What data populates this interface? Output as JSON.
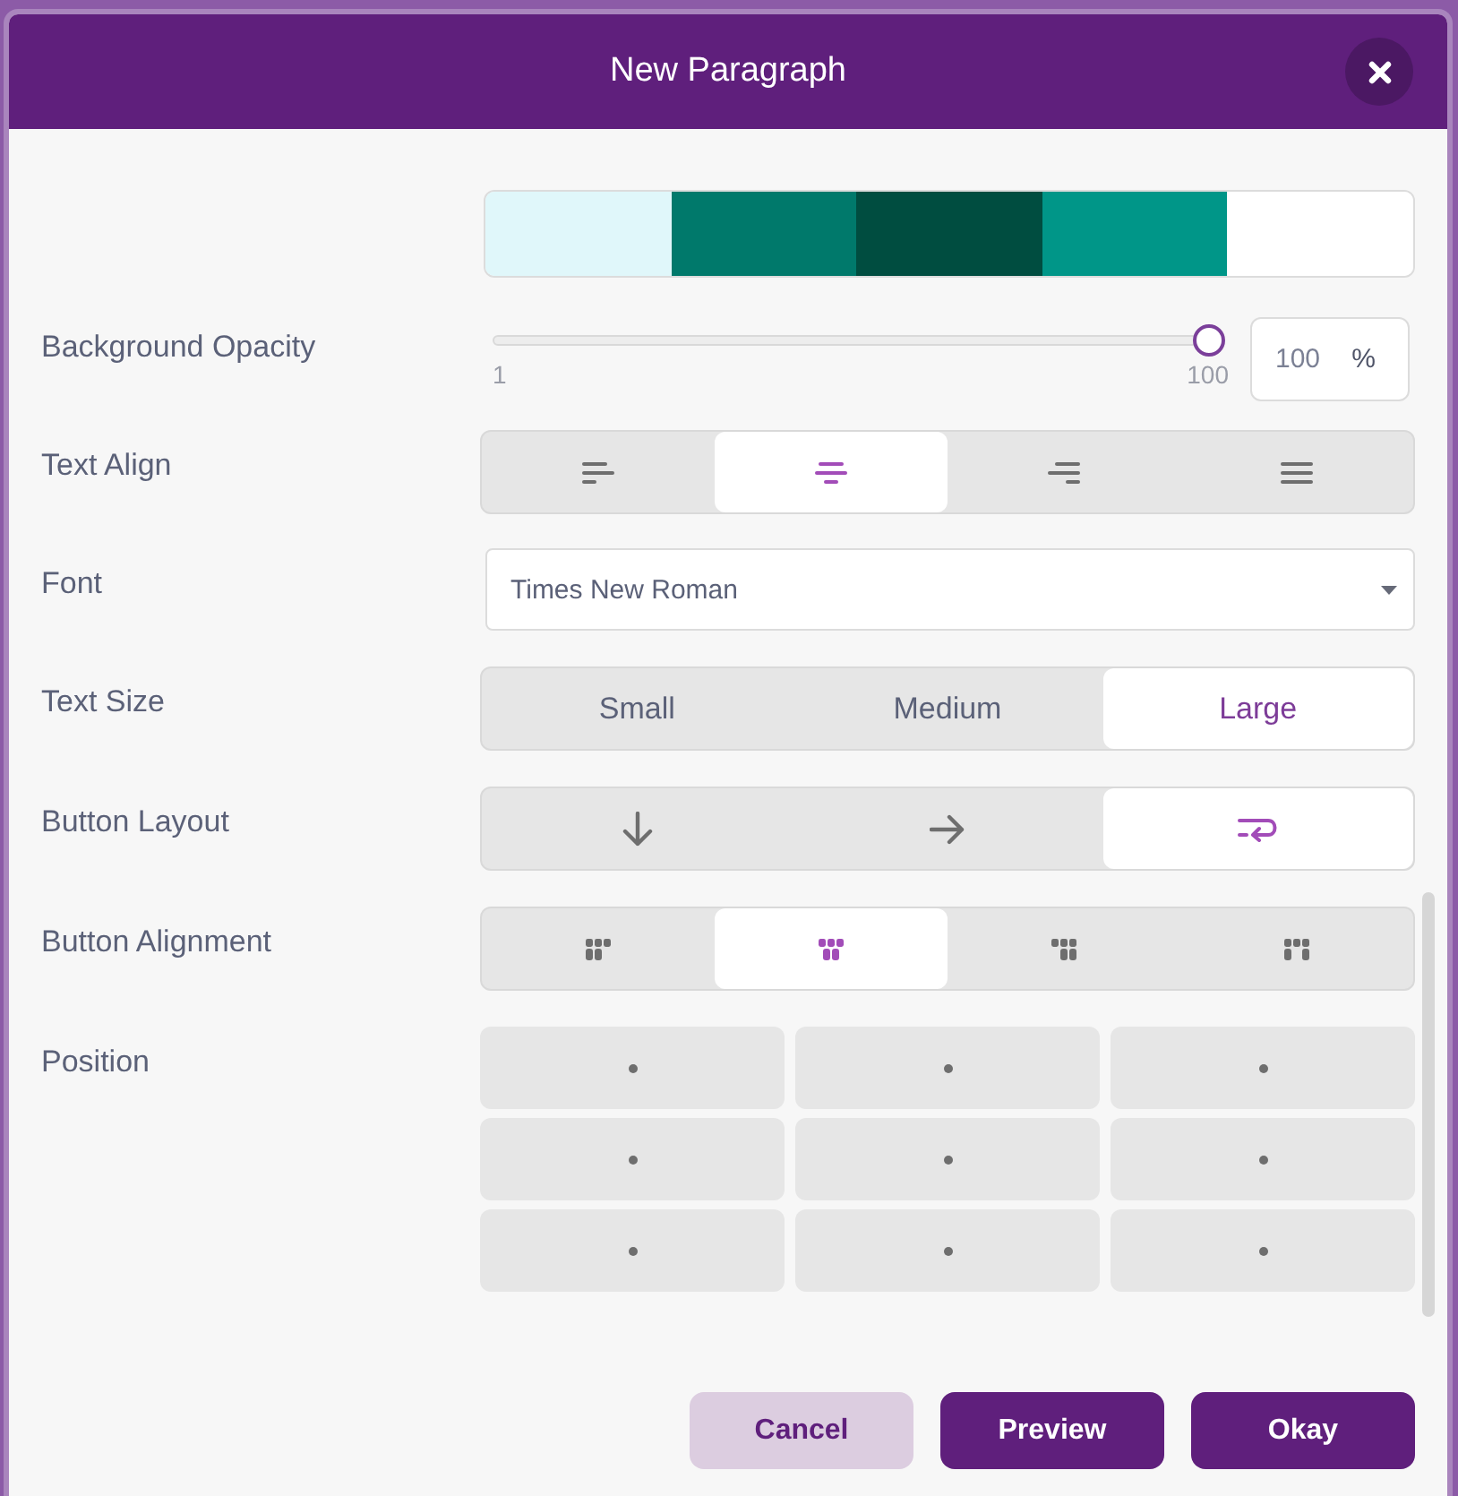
{
  "dialog": {
    "title": "New Paragraph"
  },
  "swatches": [
    {
      "color": "#e0f7fa"
    },
    {
      "color": "#00796b"
    },
    {
      "color": "#004d40"
    },
    {
      "color": "#009688"
    },
    {
      "color": "#ffffff"
    }
  ],
  "opacity": {
    "label": "Background Opacity",
    "level": 1,
    "min_label": "1",
    "max_label": "100",
    "value": "100",
    "unit": "%"
  },
  "text_align": {
    "label": "Text Align",
    "options": [
      {
        "kind": "left",
        "selected": false
      },
      {
        "kind": "center",
        "selected": true
      },
      {
        "kind": "right",
        "selected": false
      },
      {
        "kind": "justify",
        "selected": false
      }
    ]
  },
  "font": {
    "label": "Font",
    "value": "Times New Roman"
  },
  "text_size": {
    "label": "Text Size",
    "options": [
      {
        "text": "Small",
        "selected": false
      },
      {
        "text": "Medium",
        "selected": false
      },
      {
        "text": "Large",
        "selected": true
      }
    ]
  },
  "button_layout": {
    "label": "Button Layout",
    "options": [
      {
        "kind": "vertical",
        "selected": false
      },
      {
        "kind": "horizontal",
        "selected": false
      },
      {
        "kind": "wrap",
        "selected": true
      }
    ]
  },
  "button_alignment": {
    "label": "Button Alignment",
    "options": [
      {
        "kind": "left",
        "selected": false
      },
      {
        "kind": "center",
        "selected": true
      },
      {
        "kind": "right",
        "selected": false
      },
      {
        "kind": "justify",
        "selected": false
      }
    ]
  },
  "position": {
    "label": "Position",
    "cells": [
      {
        "selected": false
      },
      {
        "selected": false
      },
      {
        "selected": false
      },
      {
        "selected": false
      },
      {
        "selected": false
      },
      {
        "selected": false
      },
      {
        "selected": false
      },
      {
        "selected": false
      },
      {
        "selected": false
      }
    ]
  },
  "buttons": [
    {
      "text": "Cancel",
      "kind": "secondary"
    },
    {
      "text": "Preview",
      "kind": "primary"
    },
    {
      "text": "Okay",
      "kind": "primary"
    }
  ]
}
